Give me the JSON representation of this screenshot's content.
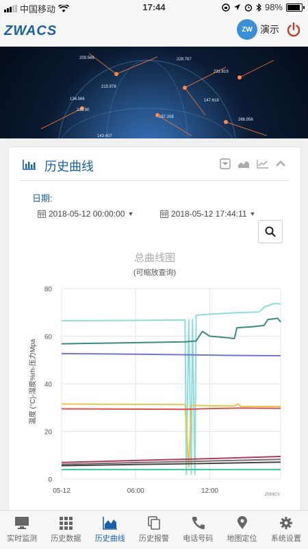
{
  "status_bar": {
    "carrier": "中国移动",
    "time": "17:44",
    "battery": "98%"
  },
  "app": {
    "logo": "ZWACS",
    "demo_label": "演示",
    "cloud_badge": "ZW"
  },
  "banner": {
    "numbers": [
      "209.566",
      "228.767",
      "231.619",
      "215.978",
      "147.618",
      "134.566",
      "215.90",
      "287.208",
      "266.956",
      "143.407"
    ]
  },
  "panel": {
    "title": "历史曲线",
    "date_label": "日期:",
    "start_date": "2018-05-12 00:00:00",
    "end_date": "2018-05-12 17:44:11"
  },
  "chart_data": {
    "type": "line",
    "title": "总曲线图",
    "subtitle": "(可缩放查询)",
    "ylabel": "温度 (°C)-湿度%rh-压力Mpa",
    "xlabel": "",
    "ylim": [
      0,
      80
    ],
    "y_ticks": [
      "0",
      "20",
      "40",
      "60",
      "80"
    ],
    "x_ticks": [
      "05-12",
      "06:00",
      "12:00"
    ],
    "x_tick_hours": [
      0,
      6,
      12
    ],
    "xlim_hours": [
      0,
      17.74
    ],
    "watermark": "zwacs",
    "grid": true,
    "series": [
      {
        "color": "#8fdcda",
        "points": [
          [
            0,
            66.5
          ],
          [
            5,
            66.6
          ],
          [
            10,
            66.8
          ],
          [
            10.1,
            2
          ],
          [
            10.3,
            66.8
          ],
          [
            10.5,
            2
          ],
          [
            10.6,
            67
          ],
          [
            10.8,
            2
          ],
          [
            10.9,
            68.8
          ],
          [
            12,
            69.2
          ],
          [
            14,
            69.8
          ],
          [
            16,
            70.2
          ],
          [
            16.5,
            72.5
          ],
          [
            17.3,
            73.8
          ],
          [
            17.74,
            73.5
          ]
        ]
      },
      {
        "color": "#3a8a82",
        "points": [
          [
            0,
            56.8
          ],
          [
            5,
            57.2
          ],
          [
            10,
            57.6
          ],
          [
            10.9,
            58
          ],
          [
            11.4,
            62
          ],
          [
            12,
            60
          ],
          [
            13.5,
            59.3
          ],
          [
            14,
            59
          ],
          [
            14.2,
            63.5
          ],
          [
            15.5,
            64
          ],
          [
            16.4,
            64.5
          ],
          [
            16.7,
            67
          ],
          [
            17.5,
            67.5
          ],
          [
            17.74,
            66
          ]
        ]
      },
      {
        "color": "#6f74d8",
        "points": [
          [
            0,
            52.7
          ],
          [
            5,
            52.5
          ],
          [
            10,
            52.2
          ],
          [
            14,
            51.9
          ],
          [
            17.74,
            51.8
          ]
        ]
      },
      {
        "color": "#e8c64e",
        "points": [
          [
            0,
            31.5
          ],
          [
            5,
            31.4
          ],
          [
            10,
            31.3
          ],
          [
            10.3,
            5
          ],
          [
            10.5,
            31
          ],
          [
            12,
            30.8
          ],
          [
            14,
            30.7
          ],
          [
            14.3,
            31.6
          ],
          [
            14.5,
            30.5
          ],
          [
            17.74,
            30.5
          ]
        ]
      },
      {
        "color": "#d9534f",
        "points": [
          [
            0,
            29.5
          ],
          [
            10,
            29.3
          ],
          [
            12,
            29.6
          ],
          [
            14.5,
            29.8
          ],
          [
            17.74,
            29.7
          ]
        ]
      },
      {
        "color": "#b03a5a",
        "points": [
          [
            0,
            7
          ],
          [
            6,
            7.8
          ],
          [
            12,
            8.6
          ],
          [
            17.74,
            9.5
          ]
        ]
      },
      {
        "color": "#7a6a6a",
        "points": [
          [
            0,
            6.2
          ],
          [
            6,
            6.9
          ],
          [
            12,
            7.6
          ],
          [
            17.74,
            8.3
          ]
        ]
      },
      {
        "color": "#444444",
        "points": [
          [
            0,
            5.6
          ],
          [
            6,
            6.1
          ],
          [
            12,
            6.6
          ],
          [
            17.74,
            7.1
          ]
        ]
      },
      {
        "color": "#3fbf9f",
        "points": [
          [
            0,
            4
          ],
          [
            10,
            4
          ],
          [
            17.74,
            4
          ]
        ]
      }
    ]
  },
  "tabs": [
    {
      "label": "实时监测",
      "icon": "monitor-icon"
    },
    {
      "label": "历史数据",
      "icon": "grid-icon"
    },
    {
      "label": "历史曲线",
      "icon": "area-chart-icon",
      "active": true
    },
    {
      "label": "历史报警",
      "icon": "copy-icon"
    },
    {
      "label": "电话号码",
      "icon": "phone-icon"
    },
    {
      "label": "地图定位",
      "icon": "map-pin-icon"
    },
    {
      "label": "系统设置",
      "icon": "gear-icon"
    }
  ]
}
